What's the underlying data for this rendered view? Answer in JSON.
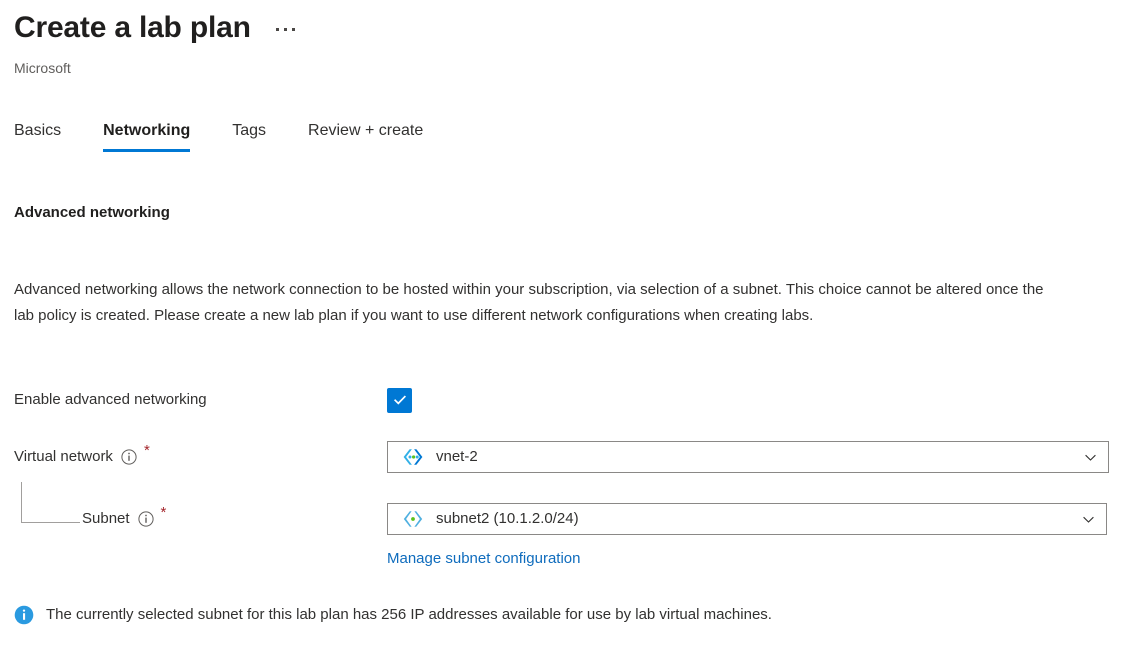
{
  "header": {
    "title": "Create a lab plan",
    "subtitle": "Microsoft",
    "more_menu_label": "More"
  },
  "tabs": [
    {
      "label": "Basics",
      "active": false
    },
    {
      "label": "Networking",
      "active": true
    },
    {
      "label": "Tags",
      "active": false
    },
    {
      "label": "Review + create",
      "active": false
    }
  ],
  "section": {
    "heading": "Advanced networking",
    "description": "Advanced networking allows the network connection to be hosted within your subscription, via selection of a subnet. This choice cannot be altered once the lab policy is created. Please create a new lab plan if you want to use different network configurations when creating labs."
  },
  "form": {
    "enable_advanced_networking": {
      "label": "Enable advanced networking",
      "checked": true
    },
    "virtual_network": {
      "label": "Virtual network",
      "required_marker": "*",
      "value": "vnet-2",
      "icon": "virtual-network-icon"
    },
    "subnet": {
      "label": "Subnet",
      "required_marker": "*",
      "value": "subnet2 (10.1.2.0/24)",
      "icon": "subnet-icon"
    },
    "manage_subnet_link": "Manage subnet configuration"
  },
  "info_message": {
    "icon": "info-filled-icon",
    "text": "The currently selected subnet for this lab plan has 256 IP addresses available for use by lab virtual machines."
  },
  "colors": {
    "accent": "#0078d4",
    "link": "#0f6cbd",
    "required": "#a4262c",
    "text": "#323130",
    "subtle_text": "#605e5c",
    "border": "#8a8886"
  }
}
